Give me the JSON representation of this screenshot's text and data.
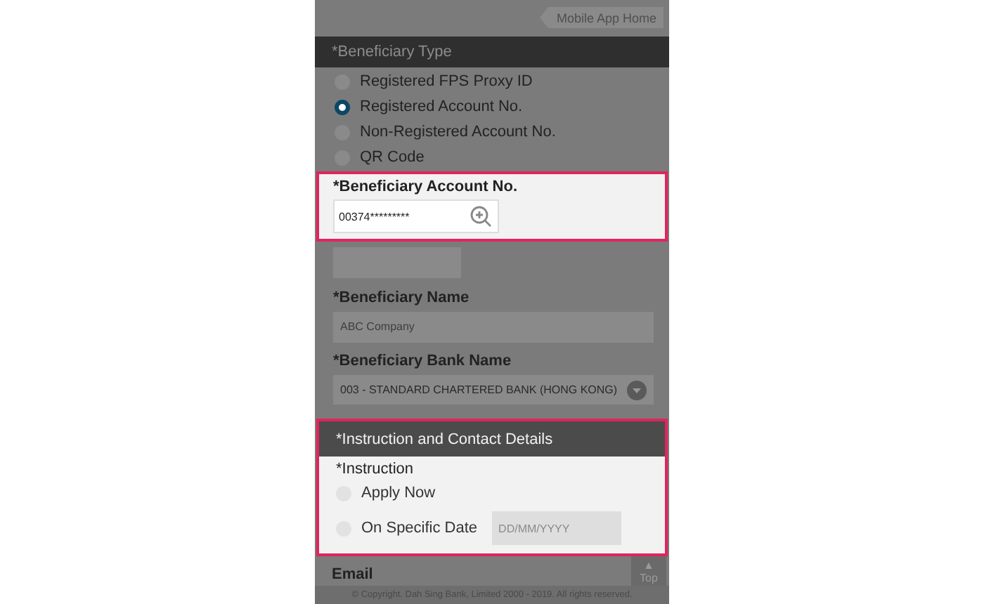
{
  "top_bar": {
    "home_button": "Mobile App Home"
  },
  "beneficiary_type": {
    "title": "*Beneficiary Type",
    "options": [
      {
        "label": "Registered FPS Proxy ID",
        "selected": false
      },
      {
        "label": "Registered Account No.",
        "selected": true
      },
      {
        "label": "Non-Registered Account No.",
        "selected": false
      },
      {
        "label": "QR Code",
        "selected": false
      }
    ]
  },
  "account_no": {
    "label": "*Beneficiary Account No.",
    "value": "00374*********"
  },
  "beneficiary_name": {
    "label": "*Beneficiary Name",
    "value": "ABC Company"
  },
  "bank_name": {
    "label": "*Beneficiary Bank Name",
    "value": "003 - STANDARD CHARTERED BANK (HONG KONG)"
  },
  "instruction": {
    "title": "*Instruction and Contact Details",
    "label": "*Instruction",
    "options": [
      {
        "label": "Apply Now",
        "selected": false
      },
      {
        "label": "On Specific Date",
        "selected": false,
        "date_placeholder": "DD/MM/YYYY"
      }
    ]
  },
  "email": {
    "label": "Email"
  },
  "top_button": {
    "arrow": "▲",
    "label": "Top"
  },
  "footer": "© Copyright. Dah Sing Bank, Limited 2000 - 2019. All rights reserved."
}
